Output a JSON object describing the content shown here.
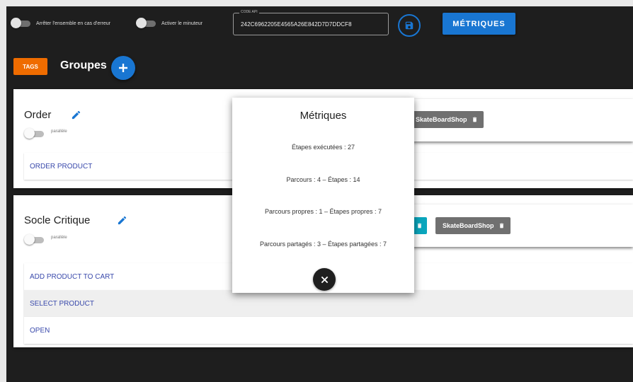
{
  "toolbar": {
    "stop_on_error_label": "Arrêter l'ensemble en cas d'erreur",
    "activate_timer_label": "Activer le minuteur",
    "api_key_label": "CODE API",
    "api_key_value": "242C6962205E4565A26E842D7D7DDCF8",
    "metrics_button": "MÉTRIQUES"
  },
  "groups_header": {
    "tags_label": "TAGS",
    "title": "Groupes"
  },
  "groups": [
    {
      "name": "Order",
      "parallel_label": "parallèle",
      "tags": [
        "SkateBoardShop"
      ],
      "steps": [
        "ORDER PRODUCT"
      ]
    },
    {
      "name": "Socle Critique",
      "parallel_label": "parallèle",
      "tags": [
        "SkateBoardShop"
      ],
      "steps": [
        "ADD PRODUCT TO CART",
        "SELECT PRODUCT",
        "OPEN"
      ]
    }
  ],
  "metrics_dialog": {
    "title": "Métriques",
    "lines": [
      "Étapes exécutées : 27",
      "Parcours : 4 – Étapes : 14",
      "Parcours propres : 1 – Étapes propres : 7",
      "Parcours partagés : 3 – Étapes partagées : 7"
    ]
  },
  "colors": {
    "primary": "#1976d2",
    "tags_chip": "#ef6c00",
    "teal_chip": "#0aa6bd",
    "background": "#1e1e1e"
  }
}
